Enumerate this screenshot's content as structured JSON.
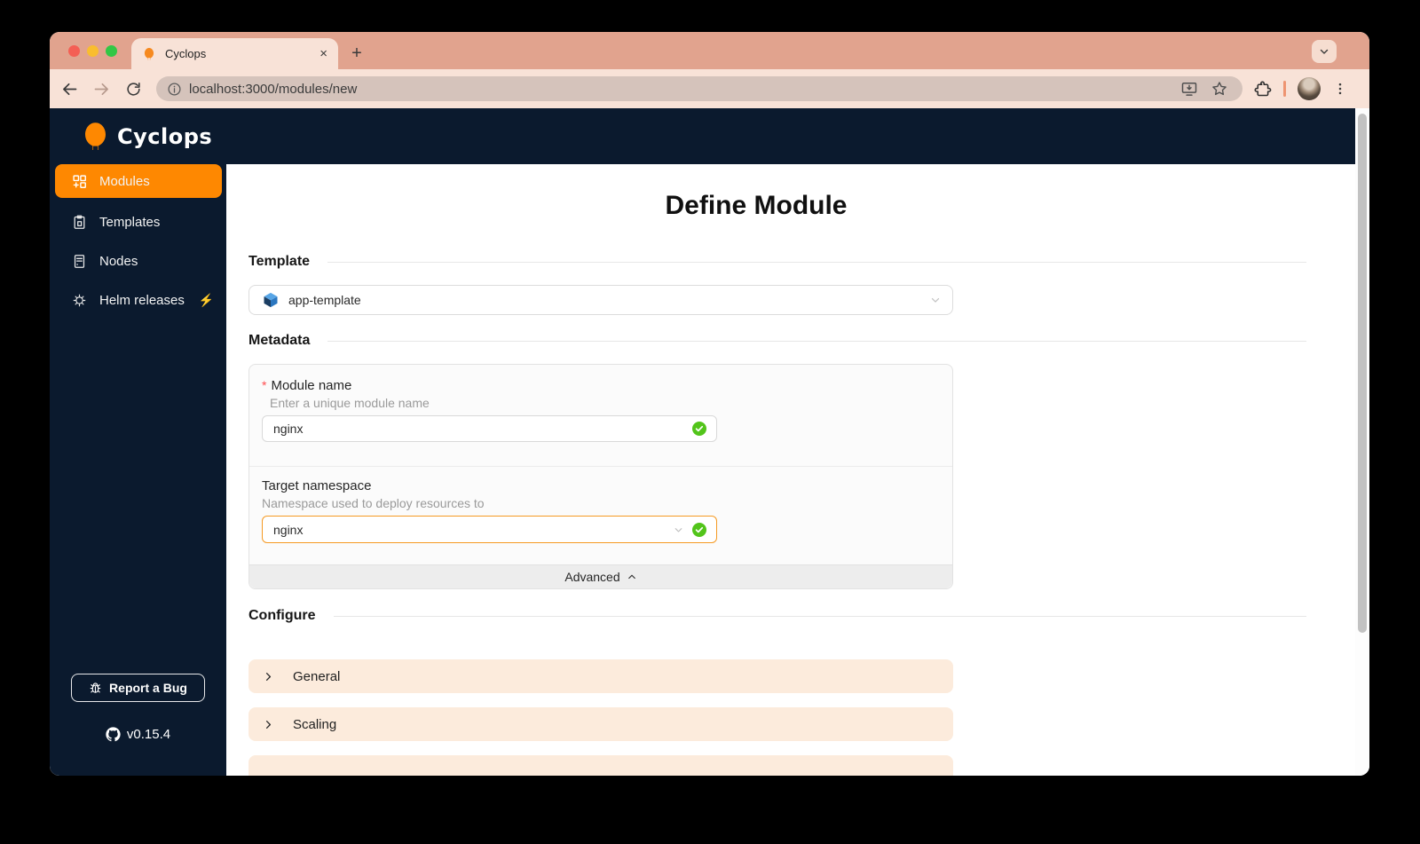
{
  "browser": {
    "tab": {
      "title": "Cyclops",
      "close": "×"
    },
    "new_tab": "+",
    "url": "localhost:3000/modules/new"
  },
  "sidebar": {
    "brand": "Cyclops",
    "nav": [
      {
        "label": "Modules"
      },
      {
        "label": "Templates"
      },
      {
        "label": "Nodes"
      },
      {
        "label": "Helm releases",
        "badge": "⚡"
      }
    ],
    "report_bug": "Report a Bug",
    "version": "v0.15.4"
  },
  "main": {
    "title": "Define Module",
    "template_section": {
      "heading": "Template",
      "selected": "app-template"
    },
    "metadata_section": {
      "heading": "Metadata",
      "module_name": {
        "required": "*",
        "label": "Module name",
        "help": "Enter a unique module name",
        "value": "nginx"
      },
      "namespace": {
        "label": "Target namespace",
        "help": "Namespace used to deploy resources to",
        "value": "nginx"
      },
      "advanced": "Advanced"
    },
    "configure_section": {
      "heading": "Configure",
      "panels": [
        {
          "label": "General"
        },
        {
          "label": "Scaling"
        }
      ]
    }
  },
  "icons": {
    "favicon": "cyclops-flame",
    "logo": "cyclops-flame",
    "modules": "appstore-add",
    "templates": "clipboard",
    "nodes": "server",
    "helm_releases": "helm-wheel",
    "report_bug": "bug",
    "version": "github",
    "template_select": "blue-cube",
    "valid": "green-check-circle",
    "select_arrow": "chevron-down",
    "advanced": "chevron-up",
    "panel": "chevron-right"
  },
  "colors": {
    "accent_orange": "#fe8801",
    "navy": "#0b1a2e",
    "success_green": "#52c41a",
    "namespace_border": "#f59a23",
    "panel_peach": "#fcebdc",
    "chrome_tabbar": "#e1a38e",
    "chrome_toolbar": "#f8e2d7"
  }
}
